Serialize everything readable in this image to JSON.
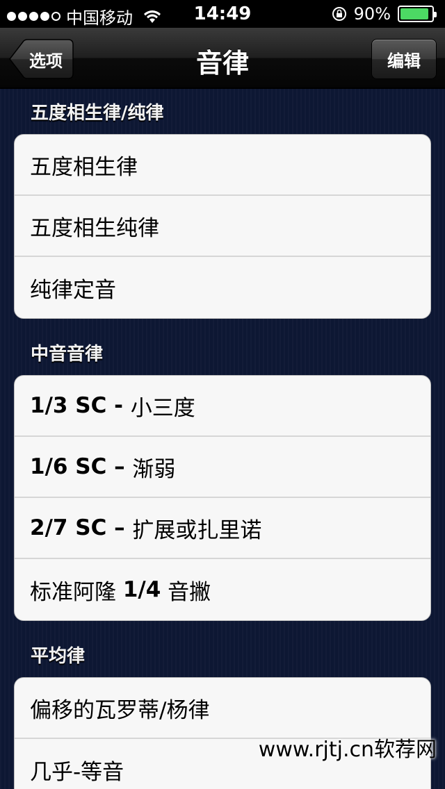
{
  "status_bar": {
    "carrier": "中国移动",
    "time": "14:49",
    "battery_percent": "90%",
    "battery_level": 0.9,
    "signal_bars_filled": 4,
    "signal_bars_total": 5
  },
  "nav": {
    "back_label": "选项",
    "title": "音律",
    "edit_label": "编辑"
  },
  "sections": [
    {
      "header": "五度相生律/纯律",
      "rows": [
        {
          "parts": [
            {
              "text": "五度相生律",
              "bold": false
            }
          ]
        },
        {
          "parts": [
            {
              "text": "五度相生纯律",
              "bold": false
            }
          ]
        },
        {
          "parts": [
            {
              "text": "纯律定音",
              "bold": false
            }
          ]
        }
      ]
    },
    {
      "header": "中音音律",
      "rows": [
        {
          "parts": [
            {
              "text": "1/3 SC - ",
              "bold": true
            },
            {
              "text": "小三度",
              "bold": false
            }
          ]
        },
        {
          "parts": [
            {
              "text": "1/6 SC – ",
              "bold": true
            },
            {
              "text": "渐弱",
              "bold": false
            }
          ]
        },
        {
          "parts": [
            {
              "text": "2/7 SC – ",
              "bold": true
            },
            {
              "text": "扩展或扎里诺",
              "bold": false
            }
          ]
        },
        {
          "parts": [
            {
              "text": "标准阿隆 ",
              "bold": false
            },
            {
              "text": "1/4",
              "bold": true
            },
            {
              "text": " 音撇",
              "bold": false
            }
          ]
        }
      ]
    },
    {
      "header": "平均律",
      "rows": [
        {
          "parts": [
            {
              "text": "偏移的瓦罗蒂/杨律",
              "bold": false
            }
          ]
        },
        {
          "parts": [
            {
              "text": "几乎-等音",
              "bold": false
            }
          ]
        }
      ]
    }
  ],
  "watermark": "www.rjtj.cn软荐网",
  "colors": {
    "background": "#0d1733",
    "battery_fill": "#4cd964",
    "group_bg": "#f7f7f7"
  }
}
